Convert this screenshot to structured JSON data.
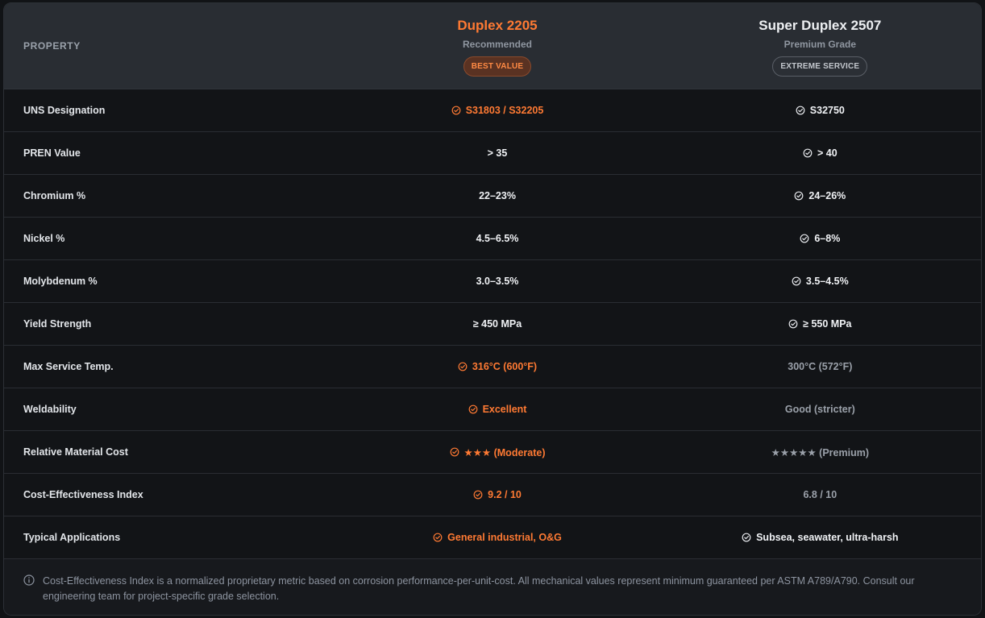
{
  "header": {
    "property_label": "PROPERTY",
    "grade_a": {
      "name": "Duplex 2205",
      "sub": "Recommended",
      "badge": "BEST VALUE"
    },
    "grade_b": {
      "name": "Super Duplex 2507",
      "sub": "Premium Grade",
      "badge": "EXTREME SERVICE"
    }
  },
  "colors": {
    "accent": "#ff7a33",
    "text": "#f0f2f5",
    "muted": "#9aa0a9"
  },
  "rows": [
    {
      "label": "UNS Designation",
      "a": "S31803 / S32205",
      "a_style": "orange",
      "a_check": true,
      "b": "S32750",
      "b_style": "white",
      "b_check": true
    },
    {
      "label": "PREN Value",
      "a": "> 35",
      "a_style": "white",
      "a_check": false,
      "b": "> 40",
      "b_style": "white",
      "b_check": true
    },
    {
      "label": "Chromium %",
      "a": "22–23%",
      "a_style": "white",
      "a_check": false,
      "b": "24–26%",
      "b_style": "white",
      "b_check": true
    },
    {
      "label": "Nickel %",
      "a": "4.5–6.5%",
      "a_style": "white",
      "a_check": false,
      "b": "6–8%",
      "b_style": "white",
      "b_check": true
    },
    {
      "label": "Molybdenum %",
      "a": "3.0–3.5%",
      "a_style": "white",
      "a_check": false,
      "b": "3.5–4.5%",
      "b_style": "white",
      "b_check": true
    },
    {
      "label": "Yield Strength",
      "a": "≥ 450 MPa",
      "a_style": "white",
      "a_check": false,
      "b": "≥ 550 MPa",
      "b_style": "white",
      "b_check": true
    },
    {
      "label": "Max Service Temp.",
      "a": "316°C (600°F)",
      "a_style": "orange",
      "a_check": true,
      "b": "300°C (572°F)",
      "b_style": "muted",
      "b_check": false
    },
    {
      "label": "Weldability",
      "a": "Excellent",
      "a_style": "orange",
      "a_check": true,
      "b": "Good (stricter)",
      "b_style": "muted",
      "b_check": false
    },
    {
      "label": "Relative Material Cost",
      "a": "★★★ (Moderate)",
      "a_style": "orange",
      "a_check": true,
      "b": "★★★★★ (Premium)",
      "b_style": "muted",
      "b_check": false
    },
    {
      "label": "Cost-Effectiveness Index",
      "a": "9.2 / 10",
      "a_style": "orange",
      "a_check": true,
      "b": "6.8 / 10",
      "b_style": "muted",
      "b_check": false
    },
    {
      "label": "Typical Applications",
      "a": "General industrial, O&G",
      "a_style": "orange",
      "a_check": true,
      "b": "Subsea, seawater, ultra-harsh",
      "b_style": "white",
      "b_check": true
    }
  ],
  "footnote": "Cost-Effectiveness Index is a normalized proprietary metric based on corrosion performance-per-unit-cost. All mechanical values represent minimum guaranteed per ASTM A789/A790. Consult our engineering team for project-specific grade selection."
}
